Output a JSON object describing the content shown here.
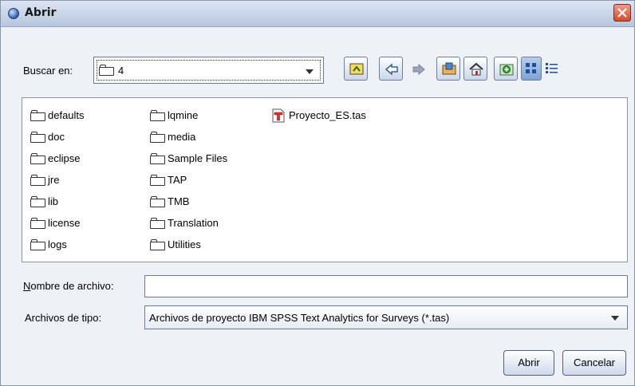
{
  "window": {
    "title": "Abrir"
  },
  "look_in": {
    "label": "Buscar en:",
    "value": "4"
  },
  "toolbar": {
    "buttons": [
      {
        "name": "up-folder-icon"
      },
      {
        "name": "back-arrow-icon"
      },
      {
        "name": "forward-arrow-icon"
      },
      {
        "name": "desktop-icon"
      },
      {
        "name": "home-icon"
      },
      {
        "name": "new-folder-icon"
      },
      {
        "name": "list-view-icon"
      },
      {
        "name": "details-view-icon"
      }
    ]
  },
  "files": {
    "column1": [
      "defaults",
      "doc",
      "eclipse",
      "jre",
      "lib",
      "license",
      "logs"
    ],
    "column2": [
      "lqmine",
      "media",
      "Sample Files",
      "TAP",
      "TMB",
      "Translation",
      "Utilities"
    ],
    "column3": [
      "Proyecto_ES.tas"
    ]
  },
  "filename": {
    "label": "Nombre de archivo:",
    "value": ""
  },
  "filetype": {
    "label": "Archivos de tipo:",
    "value": "Archivos de proyecto IBM SPSS Text Analytics for Surveys (*.tas)"
  },
  "buttons": {
    "open": "Abrir",
    "cancel": "Cancelar"
  },
  "colors": {
    "accent": "#1f5fa8",
    "close": "#d64a2c"
  }
}
